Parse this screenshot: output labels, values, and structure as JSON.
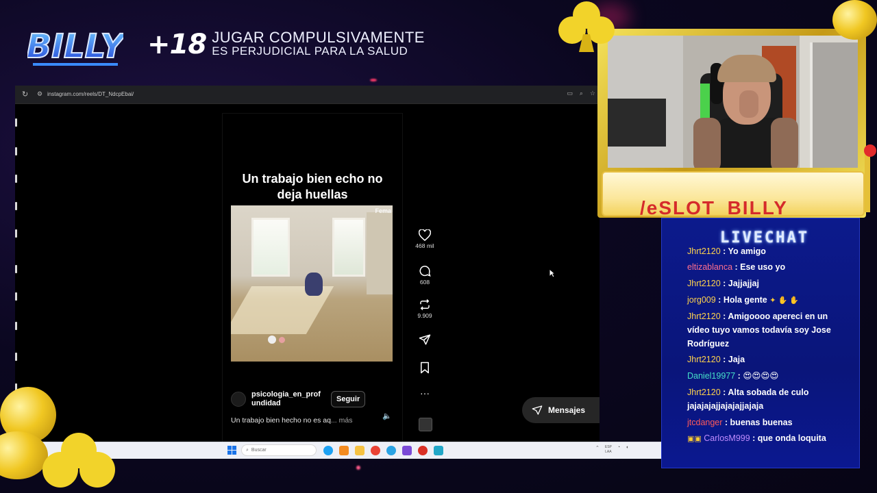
{
  "overlay": {
    "logo_text": "BILLY",
    "age_badge": "+18",
    "warning_line1": "JUGAR COMPULSIVAMENTE",
    "warning_line2": "ES PERJUDICIAL PARA LA SALUD",
    "sponsor_banner": "/eSLOT_BILLY"
  },
  "browser": {
    "url": "instagram.com/reels/DT_NdcpEbai/"
  },
  "reel": {
    "caption": "Un trabajo bien echo no deja huellas",
    "watermark": "Fema",
    "author": "psicologia_en_profundidad",
    "follow_label": "Seguir",
    "description": "Un trabajo bien hecho no es aq",
    "more_label": "... más",
    "likes": "468 mil",
    "comments": "608",
    "reposts": "9.909"
  },
  "messages_button": {
    "label": "Mensajes"
  },
  "taskbar": {
    "search_placeholder": "Buscar",
    "lang1": "ESP",
    "lang2": "LAA"
  },
  "chat": {
    "title": "LIVECHAT",
    "messages": [
      {
        "user": "Jhrt2120",
        "color": "#ffd34d",
        "text": "Yo amigo"
      },
      {
        "user": "eltizablanca",
        "color": "#ff6f8f",
        "text": "Ese uso yo"
      },
      {
        "user": "Jhrt2120",
        "color": "#ffd34d",
        "text": "Jajjajjaj"
      },
      {
        "user": "jorg009",
        "color": "#ffd34d",
        "text": "Hola gente"
      },
      {
        "user": "Jhrt2120",
        "color": "#ffd34d",
        "text": "Amigoooo apereci en un vídeo tuyo vamos todavía soy Jose Rodríguez"
      },
      {
        "user": "Jhrt2120",
        "color": "#ffd34d",
        "text": "Jaja"
      },
      {
        "user": "Daniel19977",
        "color": "#46e0c8",
        "text": "😍😍😍😍"
      },
      {
        "user": "Jhrt2120",
        "color": "#ffd34d",
        "text": "Alta sobada de culo jajajajajjajajajjajaja"
      },
      {
        "user": "jtcdanger",
        "color": "#ff5a5a",
        "text": "buenas buenas"
      },
      {
        "user": "CarlosM999",
        "color": "#c08cff",
        "text": "que onda loquita"
      }
    ]
  },
  "colors": {
    "chat_bg": "#0a157a",
    "gold": "#f0c722",
    "instagram_dark": "#000000"
  }
}
